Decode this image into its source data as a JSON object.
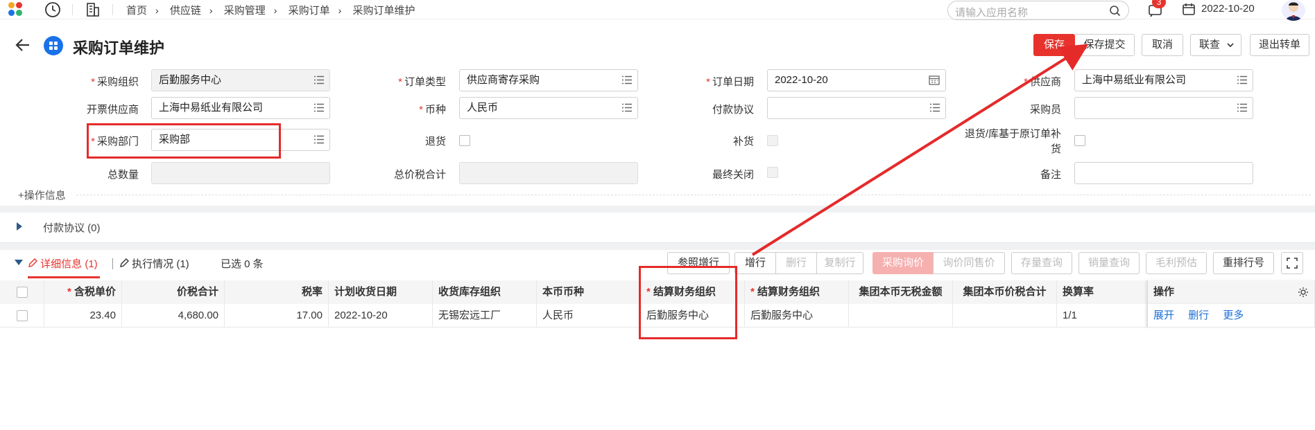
{
  "topbar": {
    "breadcrumbs": [
      "首页",
      "供应链",
      "采购管理",
      "采购订单",
      "采购订单维护"
    ],
    "search_placeholder": "请输入应用名称",
    "notification_count": "3",
    "date": "2022-10-20"
  },
  "header": {
    "title": "采购订单维护",
    "buttons": {
      "save": "保存",
      "save_submit": "保存提交",
      "cancel": "取消",
      "linked": "联查",
      "exit_transfer": "退出转单"
    }
  },
  "form": {
    "purchase_org": {
      "label": "采购组织",
      "value": "后勤服务中心"
    },
    "order_type": {
      "label": "订单类型",
      "value": "供应商寄存采购"
    },
    "order_date": {
      "label": "订单日期",
      "value": "2022-10-20"
    },
    "supplier": {
      "label": "供应商",
      "value": "上海中易纸业有限公司"
    },
    "invoice_supplier": {
      "label": "开票供应商",
      "value": "上海中易纸业有限公司"
    },
    "currency": {
      "label": "币种",
      "value": "人民币"
    },
    "payment_terms": {
      "label": "付款协议",
      "value": ""
    },
    "buyer": {
      "label": "采购员",
      "value": ""
    },
    "purchase_dept": {
      "label": "采购部门",
      "value": "采购部"
    },
    "return": {
      "label": "退货"
    },
    "replenish": {
      "label": "补货"
    },
    "return_based": {
      "label_line1": "退货/库基于原订单补",
      "label_line2": "货"
    },
    "total_qty": {
      "label": "总数量",
      "value": ""
    },
    "total_price_tax": {
      "label": "总价税合计",
      "value": ""
    },
    "final_close": {
      "label": "最终关闭"
    },
    "remark": {
      "label": "备注",
      "value": ""
    },
    "op_info": "+操作信息"
  },
  "payment_section": {
    "label": "付款协议 (0)"
  },
  "detail": {
    "tab_detail": "详细信息 (1)",
    "tab_exec": "执行情况 (1)",
    "selected": "已选 0 条",
    "toolbar": {
      "ref_add": "参照增行",
      "add_row": "增行",
      "del_row": "删行",
      "copy_row": "复制行",
      "purchase_inquiry": "采购询价",
      "inquiry_price": "询价同售价",
      "stock_query": "存量查询",
      "sales_query": "销量查询",
      "gross_estimate": "毛利预估",
      "renumber": "重排行号"
    },
    "columns": [
      "含税单价",
      "价税合计",
      "税率",
      "计划收货日期",
      "收货库存组织",
      "本币币种",
      "结算财务组织",
      "结算财务组织",
      "集团本币无税金额",
      "集团本币价税合计",
      "换算率",
      "操作"
    ],
    "rows": [
      {
        "unit_price_tax": "23.40",
        "total_tax": "4,680.00",
        "tax_rate": "17.00",
        "plan_date": "2022-10-20",
        "recv_org": "无锡宏远工厂",
        "currency": "人民币",
        "settle_org1": "后勤服务中心",
        "settle_org2": "后勤服务中心",
        "grp_notax": "",
        "grp_tax": "",
        "rate": "1/1",
        "actions": [
          "展开",
          "删行",
          "更多"
        ]
      }
    ]
  }
}
